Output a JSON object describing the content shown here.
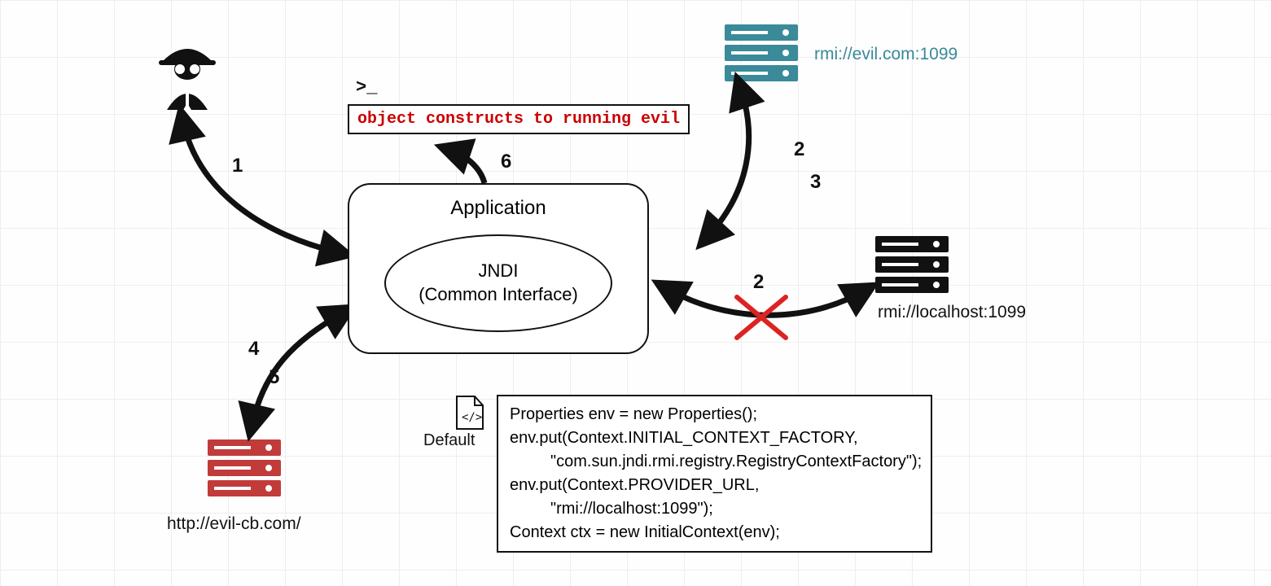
{
  "hacker_label": "",
  "terminal_prompt": ">_",
  "terminal_text": "object constructs to running evil",
  "application": {
    "title": "Application",
    "jndi_line1": "JNDI",
    "jndi_line2": "(Common Interface)"
  },
  "servers": {
    "rmi_evil": "rmi://evil.com:1099",
    "rmi_local": "rmi://localhost:1099",
    "http_evil": "http://evil-cb.com/"
  },
  "steps": {
    "s1": "1",
    "s2": "2",
    "s3": "3",
    "s4": "4",
    "s5": "5",
    "s6": "6",
    "s2x": "2"
  },
  "default_label": "Default",
  "code": {
    "l1": "Properties env = new Properties();",
    "l2": "env.put(Context.INITIAL_CONTEXT_FACTORY,",
    "l3": "\"com.sun.jndi.rmi.registry.RegistryContextFactory\");",
    "l4": "env.put(Context.PROVIDER_URL,",
    "l5": "\"rmi://localhost:1099\");",
    "l6": "Context ctx = new InitialContext(env);"
  }
}
